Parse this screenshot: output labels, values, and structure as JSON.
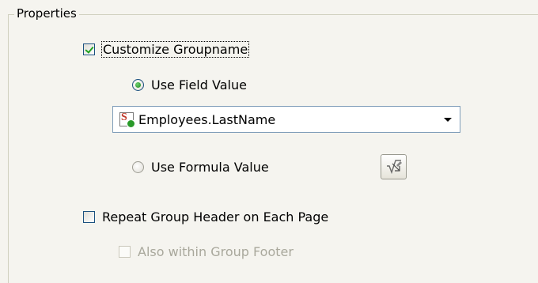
{
  "group": {
    "legend": "Properties"
  },
  "customize_groupname": {
    "label": "Customize Groupname",
    "checked": true
  },
  "use_field_value": {
    "label": "Use Field Value",
    "selected": true
  },
  "field_combo": {
    "value": "Employees.LastName",
    "icon": "sql-field-icon"
  },
  "use_formula_value": {
    "label": "Use Formula Value",
    "selected": false
  },
  "formula_button": {
    "icon": "formula-editor-icon"
  },
  "repeat_group_header": {
    "label": "Repeat Group Header on Each Page",
    "checked": false
  },
  "also_within_footer": {
    "label": "Also within Group Footer",
    "checked": false,
    "enabled": false
  }
}
